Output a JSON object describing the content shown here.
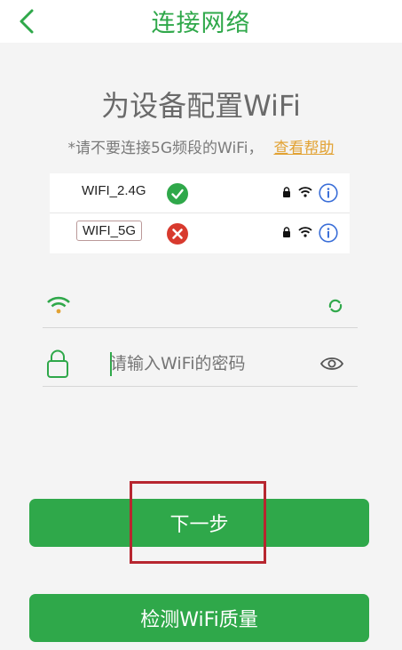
{
  "header": {
    "title": "连接网络"
  },
  "main": {
    "heading": "为设备配置WiFi",
    "note": "*请不要连接5G频段的WiFi，",
    "help_link": "查看帮助"
  },
  "wifi_list": [
    {
      "ssid": "WIFI_2.4G",
      "status": "ok"
    },
    {
      "ssid": "WIFI_5G",
      "status": "error"
    }
  ],
  "password_field": {
    "placeholder": "请输入WiFi的密码"
  },
  "buttons": {
    "next": "下一步",
    "check": "检测WiFi质量"
  },
  "colors": {
    "brand_green": "#2fa84a",
    "help_orange": "#e2a233",
    "error_red": "#d83a2e",
    "highlight_red": "#b7262f"
  }
}
